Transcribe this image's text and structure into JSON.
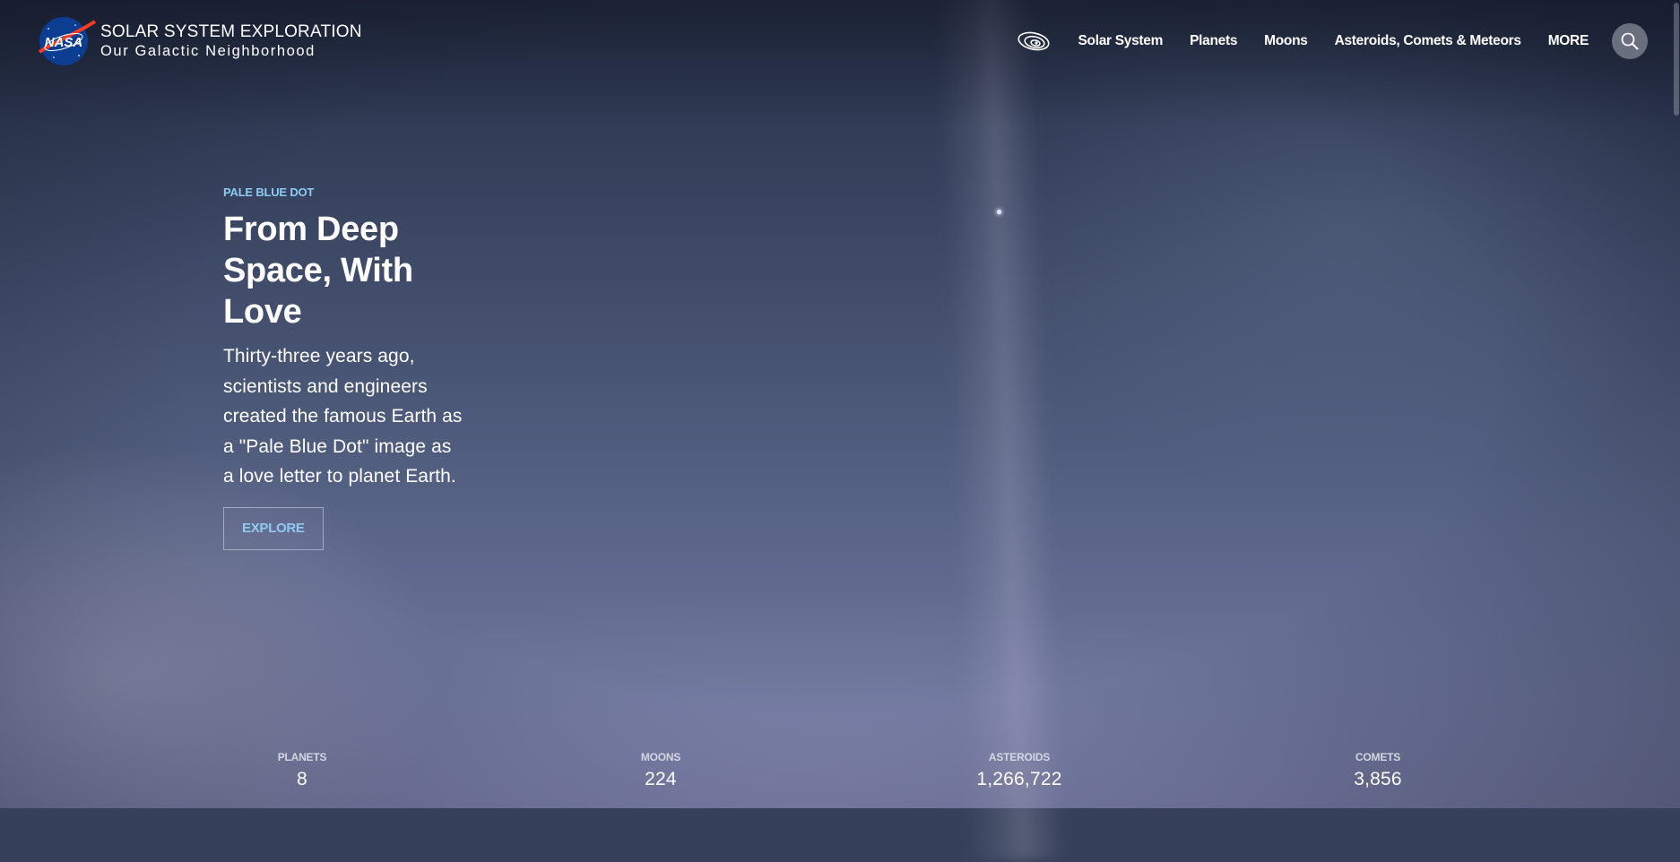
{
  "header": {
    "title": "SOLAR SYSTEM EXPLORATION",
    "subtitle": "Our Galactic Neighborhood",
    "logo_text": "NASA"
  },
  "nav": {
    "icon": "solar-system-orbit-icon",
    "items": [
      {
        "label": "Solar System"
      },
      {
        "label": "Planets"
      },
      {
        "label": "Moons"
      },
      {
        "label": "Asteroids, Comets & Meteors"
      },
      {
        "label": "MORE"
      }
    ],
    "search_icon": "search-icon"
  },
  "hero": {
    "eyebrow": "PALE BLUE DOT",
    "title": "From Deep Space, With Love",
    "description": "Thirty-three years ago, scientists and engineers created the famous Earth as a \"Pale Blue Dot\" image as a love letter to planet Earth.",
    "button_label": "EXPLORE"
  },
  "stats": [
    {
      "label": "PLANETS",
      "value": "8"
    },
    {
      "label": "MOONS",
      "value": "224"
    },
    {
      "label": "ASTEROIDS",
      "value": "1,266,722"
    },
    {
      "label": "COMETS",
      "value": "3,856"
    }
  ],
  "colors": {
    "accent": "#8fcaf2",
    "nasa_blue": "#0b3d91",
    "nasa_red": "#fc3d21"
  }
}
